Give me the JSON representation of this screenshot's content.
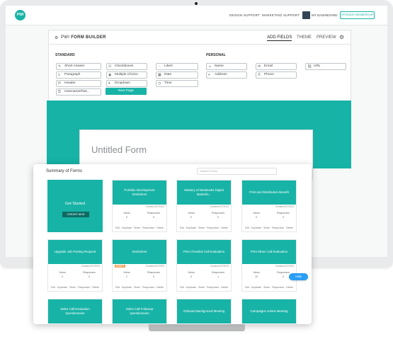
{
  "nav": {
    "logo": "PWI",
    "links": [
      "DESIGN SUPPORT",
      "MARKETING SUPPORT"
    ],
    "dashboard": "MY DASHBOARD",
    "upgrade": "UPGRADE MEMBERSHIP"
  },
  "builder": {
    "title_prefix": "PWI",
    "title_bold": "FORM BUILDER",
    "tabs": [
      "ADD FIELDS",
      "THEME",
      "PREVIEW"
    ],
    "standard_label": "STANDARD",
    "personal_label": "PERSONAL",
    "standard_fields": [
      "Short Answer",
      "Paragraph",
      "Header",
      "Username/Pas...",
      "Checkboxes",
      "Multiple Choice",
      "Dropdown",
      "Likert",
      "Date",
      "Time"
    ],
    "personal_fields": [
      "Name",
      "Address",
      "Email",
      "Phone",
      "URL"
    ],
    "new_page": "New Page"
  },
  "form": {
    "title": "Untitled Form"
  },
  "summary": {
    "title": "Summary of Forms",
    "search_placeholder": "Search Forms",
    "get_started": "Get Started",
    "create_new": "CREATE NEW",
    "views_label": "Views",
    "responses_label": "Responses",
    "actions": "Edit · Duplicate · Share · Responses · Delete",
    "tiles": [
      {
        "name": "Portfolio Development Worksheet",
        "created": "Created 6/7/2023",
        "views": "0",
        "responses": "0"
      },
      {
        "name": "Mastery of Newbooks Digital Marketin...",
        "created": "Created 6/7/2023",
        "views": "0",
        "responses": "0"
      },
      {
        "name": "Print and Distribution Benefit",
        "created": "Created 6/7/2023",
        "views": "0",
        "responses": "0"
      },
      {
        "name": "Upgrade Job Posting Request",
        "created": "Created 6/7/2023",
        "views": "0",
        "responses": "0"
      },
      {
        "name": "Worksheet",
        "created": "Created 6/7/2023",
        "badge": "DRAFT",
        "views": "2",
        "responses": "0"
      },
      {
        "name": "Print Checklist Call Evaluation",
        "created": "Created 6/7/2023",
        "views": "0",
        "responses": "1"
      },
      {
        "name": "Print Share Call Evaluation",
        "created": "Created 6/7/2023",
        "views": "10",
        "responses": "0"
      },
      {
        "name": "Sales Call Evaluation Questionnaire",
        "created": "",
        "views": "",
        "responses": ""
      },
      {
        "name": "Sales Call Followup Questionnaire",
        "created": "",
        "views": "",
        "responses": ""
      },
      {
        "name": "Onboard Background Meeting",
        "created": "",
        "views": "",
        "responses": ""
      },
      {
        "name": "Campaigns review Meeting",
        "created": "",
        "views": "",
        "responses": ""
      }
    ]
  },
  "help": "Help"
}
